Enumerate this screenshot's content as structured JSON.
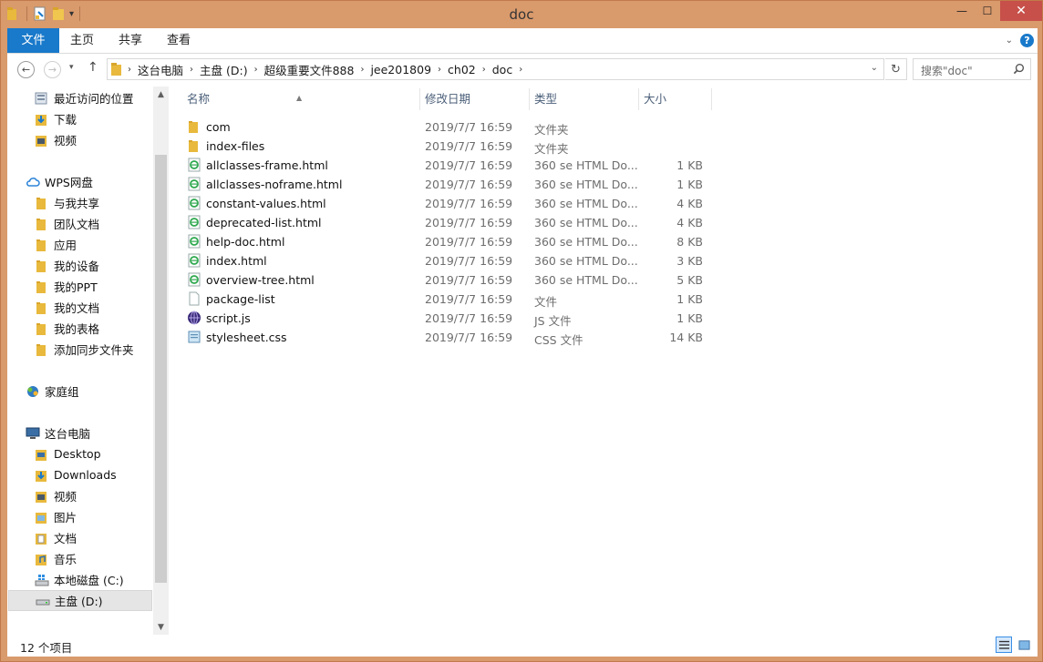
{
  "window": {
    "title": "doc",
    "controls": {
      "minimize": "—",
      "maximize": "☐",
      "close": "✕"
    }
  },
  "ribbon": {
    "tabs": [
      "文件",
      "主页",
      "共享",
      "查看"
    ],
    "help": "?"
  },
  "address": {
    "crumbs": [
      "这台电脑",
      "主盘 (D:)",
      "超级重要文件888",
      "jee201809",
      "ch02",
      "doc"
    ]
  },
  "search": {
    "placeholder": "搜索\"doc\""
  },
  "nav": {
    "items": [
      {
        "label": "最近访问的位置",
        "icon": "recent-icon"
      },
      {
        "label": "下载",
        "icon": "downloads-icon"
      },
      {
        "label": "视频",
        "icon": "video-icon"
      },
      {
        "label": "WPS网盘",
        "icon": "cloud-icon"
      },
      {
        "label": "与我共享",
        "icon": "folder-icon"
      },
      {
        "label": "团队文档",
        "icon": "folder-icon"
      },
      {
        "label": "应用",
        "icon": "folder-icon"
      },
      {
        "label": "我的设备",
        "icon": "folder-icon"
      },
      {
        "label": "我的PPT",
        "icon": "folder-icon"
      },
      {
        "label": "我的文档",
        "icon": "folder-icon"
      },
      {
        "label": "我的表格",
        "icon": "folder-icon"
      },
      {
        "label": "添加同步文件夹",
        "icon": "folder-icon"
      },
      {
        "label": "家庭组",
        "icon": "homegroup-icon"
      },
      {
        "label": "这台电脑",
        "icon": "computer-icon"
      },
      {
        "label": "Desktop",
        "icon": "desktop-folder-icon"
      },
      {
        "label": "Downloads",
        "icon": "downloads-icon"
      },
      {
        "label": "视频",
        "icon": "video-icon"
      },
      {
        "label": "图片",
        "icon": "pictures-icon"
      },
      {
        "label": "文档",
        "icon": "documents-icon"
      },
      {
        "label": "音乐",
        "icon": "music-icon"
      },
      {
        "label": "本地磁盘 (C:)",
        "icon": "system-drive-icon"
      },
      {
        "label": "主盘 (D:)",
        "icon": "drive-icon"
      }
    ]
  },
  "columns": {
    "name": "名称",
    "date": "修改日期",
    "type": "类型",
    "size": "大小"
  },
  "files": [
    {
      "name": "com",
      "date": "2019/7/7 16:59",
      "type": "文件夹",
      "size": "",
      "icon": "folder-icon"
    },
    {
      "name": "index-files",
      "date": "2019/7/7 16:59",
      "type": "文件夹",
      "size": "",
      "icon": "folder-icon"
    },
    {
      "name": "allclasses-frame.html",
      "date": "2019/7/7 16:59",
      "type": "360 se HTML Do...",
      "size": "1 KB",
      "icon": "html-file-icon"
    },
    {
      "name": "allclasses-noframe.html",
      "date": "2019/7/7 16:59",
      "type": "360 se HTML Do...",
      "size": "1 KB",
      "icon": "html-file-icon"
    },
    {
      "name": "constant-values.html",
      "date": "2019/7/7 16:59",
      "type": "360 se HTML Do...",
      "size": "4 KB",
      "icon": "html-file-icon"
    },
    {
      "name": "deprecated-list.html",
      "date": "2019/7/7 16:59",
      "type": "360 se HTML Do...",
      "size": "4 KB",
      "icon": "html-file-icon"
    },
    {
      "name": "help-doc.html",
      "date": "2019/7/7 16:59",
      "type": "360 se HTML Do...",
      "size": "8 KB",
      "icon": "html-file-icon"
    },
    {
      "name": "index.html",
      "date": "2019/7/7 16:59",
      "type": "360 se HTML Do...",
      "size": "3 KB",
      "icon": "html-file-icon"
    },
    {
      "name": "overview-tree.html",
      "date": "2019/7/7 16:59",
      "type": "360 se HTML Do...",
      "size": "5 KB",
      "icon": "html-file-icon"
    },
    {
      "name": "package-list",
      "date": "2019/7/7 16:59",
      "type": "文件",
      "size": "1 KB",
      "icon": "blank-file-icon"
    },
    {
      "name": "script.js",
      "date": "2019/7/7 16:59",
      "type": "JS 文件",
      "size": "1 KB",
      "icon": "js-file-icon"
    },
    {
      "name": "stylesheet.css",
      "date": "2019/7/7 16:59",
      "type": "CSS 文件",
      "size": "14 KB",
      "icon": "css-file-icon"
    }
  ],
  "status": {
    "count": "12 个项目"
  },
  "colors": {
    "accent": "#1979ca",
    "frame": "#d99a6c",
    "close": "#c7504a",
    "header_text": "#4c607a"
  }
}
